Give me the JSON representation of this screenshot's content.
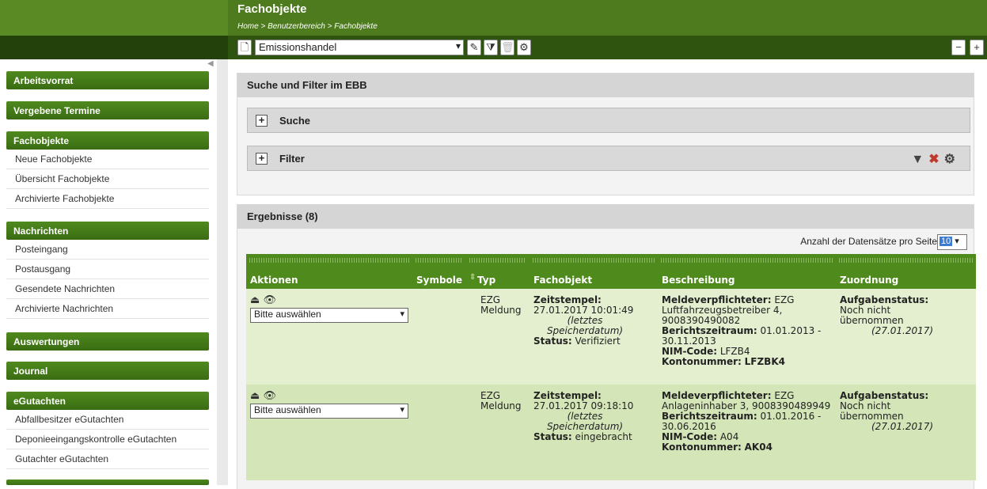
{
  "header": {
    "title": "Fachobjekte",
    "breadcrumb": "Home > Benutzerbereich > Fachobjekte"
  },
  "toolbar": {
    "selected_fachobjekt": "Emissionshandel"
  },
  "sidebar": {
    "sections": [
      {
        "label": "Arbeitsvorrat"
      },
      {
        "label": "Vergebene Termine"
      },
      {
        "label": "Fachobjekte",
        "items": [
          "Neue Fachobjekte",
          "Übersicht Fachobjekte",
          "Archivierte Fachobjekte"
        ]
      },
      {
        "label": "Nachrichten",
        "items": [
          "Posteingang",
          "Postausgang",
          "Gesendete Nachrichten",
          "Archivierte Nachrichten"
        ]
      },
      {
        "label": "Auswertungen"
      },
      {
        "label": "Journal"
      },
      {
        "label": "eGutachten",
        "items": [
          "Abfallbesitzer eGutachten",
          "Deponieeingangskontrolle eGutachten",
          "Gutachter eGutachten"
        ]
      }
    ]
  },
  "search_panel": {
    "title": "Suche und Filter im EBB",
    "search_label": "Suche",
    "filter_label": "Filter"
  },
  "results": {
    "title": "Ergebnisse (8)",
    "per_page_label": "Anzahl der Datensätze pro Seite",
    "per_page_value": "10",
    "columns": [
      "Aktionen",
      "Symbole",
      "Typ",
      "Fachobjekt",
      "Beschreibung",
      "Zuordnung"
    ],
    "action_placeholder": "Bitte auswählen",
    "rows": [
      {
        "typ": "EZG Meldung",
        "zeitstempel_label": "Zeitstempel:",
        "zeitstempel": "27.01.2017 10:01:49",
        "zeitstempel_note": "(letztes Speicherdatum)",
        "status_label": "Status:",
        "status": "Verifiziert",
        "meldepflichtiger_label": "Meldeverpflichteter:",
        "meldepflichtiger": "EZG Luftfahrzeugsbetreiber 4, 9008390490082",
        "berichtszeitraum_label": "Berichtszeitraum:",
        "berichtszeitraum": "01.01.2013 - 30.11.2013",
        "nim_label": "NIM-Code:",
        "nim": "LFZB4",
        "konto_label": "Kontonummer:",
        "konto": "LFZBK4",
        "aufgabenstatus_label": "Aufgabenstatus:",
        "aufgabenstatus": "Noch nicht übernommen",
        "aufgabenstatus_date": "(27.01.2017)"
      },
      {
        "typ": "EZG Meldung",
        "zeitstempel_label": "Zeitstempel:",
        "zeitstempel": "27.01.2017 09:18:10",
        "zeitstempel_note": "(letztes Speicherdatum)",
        "status_label": "Status:",
        "status": "eingebracht",
        "meldepflichtiger_label": "Meldeverpflichteter:",
        "meldepflichtiger": "EZG Anlageninhaber 3, 9008390489949",
        "berichtszeitraum_label": "Berichtszeitraum:",
        "berichtszeitraum": "01.01.2016 - 30.06.2016",
        "nim_label": "NIM-Code:",
        "nim": "A04",
        "konto_label": "Kontonummer:",
        "konto": "AK04",
        "aufgabenstatus_label": "Aufgabenstatus:",
        "aufgabenstatus": "Noch nicht übernommen",
        "aufgabenstatus_date": "(27.01.2017)"
      }
    ]
  },
  "colors": {
    "header_green": "#4e7b1e",
    "toolbar_green": "#2f5410",
    "table_header_green": "#4e8a1c",
    "row_odd": "#e3efcf",
    "row_even": "#d4e6b8"
  }
}
